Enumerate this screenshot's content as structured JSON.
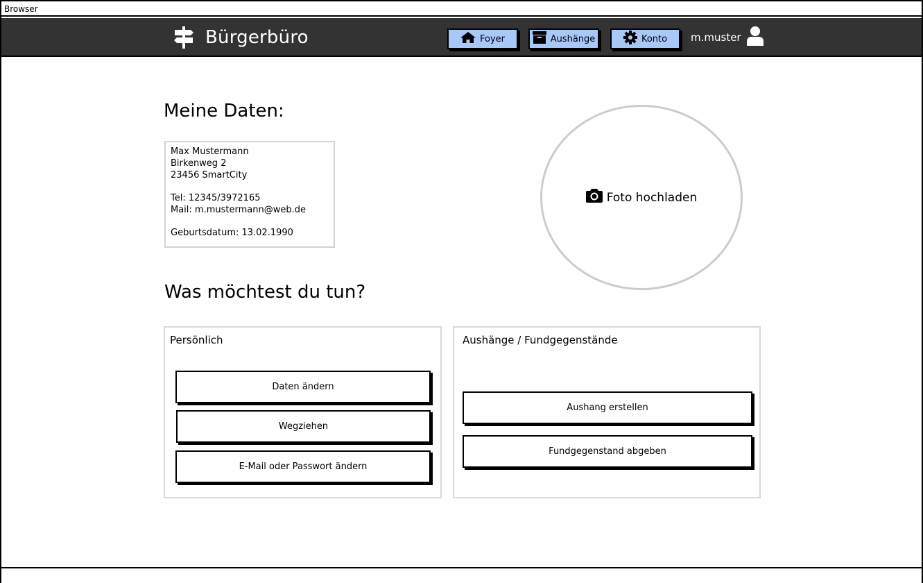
{
  "window": {
    "title": "Browser"
  },
  "navbar": {
    "brand": "Bürgerbüro",
    "items": [
      {
        "label": "Foyer",
        "icon": "home-icon"
      },
      {
        "label": "Aushänge",
        "icon": "archive-icon"
      },
      {
        "label": "Konto",
        "icon": "gear-icon"
      }
    ],
    "username": "m.muster",
    "accent": "#a7c9fa",
    "background": "#333333"
  },
  "profile": {
    "heading": "Meine Daten:",
    "name": "Max Mustermann",
    "street": "Birkenweg 2",
    "city": "23456 SmartCity",
    "phone": "Tel: 12345/3972165",
    "mail": "Mail: m.mustermann@web.de",
    "birthdate": "Geburtsdatum: 13.02.1990",
    "photo_label": "Foto hochladen"
  },
  "actions": {
    "heading": "Was möchtest du tun?",
    "personal": {
      "title": "Persönlich",
      "buttons": [
        "Daten ändern",
        "Wegziehen",
        "E-Mail oder Passwort ändern"
      ]
    },
    "postings": {
      "title": "Aushänge / Fundgegenstände",
      "buttons": [
        "Aushang erstellen",
        "Fundgegenstand abgeben"
      ]
    }
  }
}
